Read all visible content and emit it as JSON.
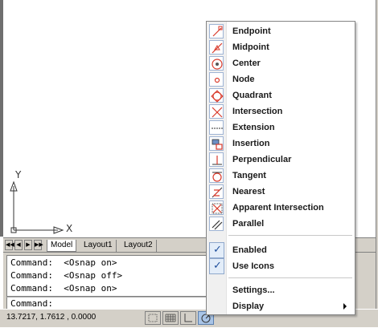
{
  "ucs": {
    "x_label": "X",
    "y_label": "Y"
  },
  "tabs": {
    "items": [
      {
        "label": "Model",
        "active": true
      },
      {
        "label": "Layout1",
        "active": false
      },
      {
        "label": "Layout2",
        "active": false
      }
    ]
  },
  "command": {
    "history": [
      "Command:  <Osnap on>",
      "Command:  <Osnap off>",
      "Command:  <Osnap on>"
    ],
    "prompt": "Command:"
  },
  "status": {
    "coordinates": "13.7217, 1.7612 , 0.0000"
  },
  "menu": {
    "snaps": [
      {
        "label": "Endpoint",
        "icon": "endpoint-snap-icon"
      },
      {
        "label": "Midpoint",
        "icon": "midpoint-snap-icon"
      },
      {
        "label": "Center",
        "icon": "center-snap-icon"
      },
      {
        "label": "Node",
        "icon": "node-snap-icon"
      },
      {
        "label": "Quadrant",
        "icon": "quadrant-snap-icon"
      },
      {
        "label": "Intersection",
        "icon": "intersection-snap-icon"
      },
      {
        "label": "Extension",
        "icon": "extension-snap-icon"
      },
      {
        "label": "Insertion",
        "icon": "insertion-snap-icon"
      },
      {
        "label": "Perpendicular",
        "icon": "perpendicular-snap-icon"
      },
      {
        "label": "Tangent",
        "icon": "tangent-snap-icon"
      },
      {
        "label": "Nearest",
        "icon": "nearest-snap-icon"
      },
      {
        "label": "Apparent Intersection",
        "icon": "apparent-intersection-snap-icon"
      },
      {
        "label": "Parallel",
        "icon": "parallel-snap-icon"
      }
    ],
    "toggles": [
      {
        "label": "Enabled",
        "checked": true
      },
      {
        "label": "Use Icons",
        "checked": true
      }
    ],
    "settings_label": "Settings...",
    "display_label": "Display"
  },
  "colors": {
    "menu_icon_red": "#d93a2b",
    "check_blue": "#1f4f9c",
    "ui_gray": "#d4d0c8"
  }
}
